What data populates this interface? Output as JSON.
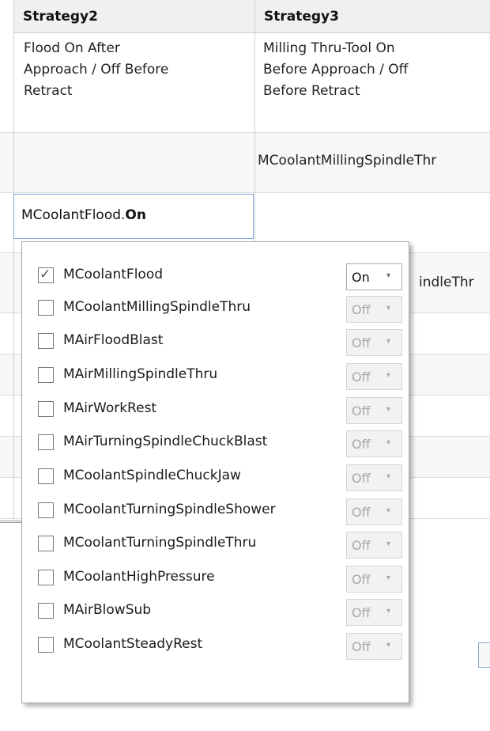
{
  "columns": {
    "strategy2": "Strategy2",
    "strategy3": "Strategy3"
  },
  "rows": {
    "description": {
      "strategy2": "Flood On After\nApproach / Off Before\nRetract",
      "strategy3": "Milling Thru-Tool On\nBefore Approach / Off\nBefore Retract"
    },
    "approach_code": {
      "strategy2": "",
      "strategy3": "MCoolantMillingSpindleThr"
    },
    "editing_cell": {
      "prefix": "MCoolantFlood.",
      "suffix": "On"
    },
    "partial_behind_popup": "indleThr"
  },
  "popup": {
    "items": [
      {
        "label": "MCoolantFlood",
        "checked": true,
        "value": "On"
      },
      {
        "label": "MCoolantMillingSpindleThru",
        "checked": false,
        "value": "Off"
      },
      {
        "label": "MAirFloodBlast",
        "checked": false,
        "value": "Off"
      },
      {
        "label": "MAirMillingSpindleThru",
        "checked": false,
        "value": "Off"
      },
      {
        "label": "MAirWorkRest",
        "checked": false,
        "value": "Off"
      },
      {
        "label": "MAirTurningSpindleChuckBlast",
        "checked": false,
        "value": "Off"
      },
      {
        "label": "MCoolantSpindleChuckJaw",
        "checked": false,
        "value": "Off"
      },
      {
        "label": "MCoolantTurningSpindleShower",
        "checked": false,
        "value": "Off"
      },
      {
        "label": "MCoolantTurningSpindleThru",
        "checked": false,
        "value": "Off"
      },
      {
        "label": "MCoolantHighPressure",
        "checked": false,
        "value": "Off"
      },
      {
        "label": "MAirBlowSub",
        "checked": false,
        "value": "Off"
      },
      {
        "label": "MCoolantSteadyRest",
        "checked": false,
        "value": "Off"
      }
    ],
    "check_glyph": "✓",
    "arrow_glyph": "▾"
  },
  "colors": {
    "header_bg": "#f0f0f0",
    "row_alt": "#f7f7f7",
    "edit_border": "#7aa7d9"
  }
}
